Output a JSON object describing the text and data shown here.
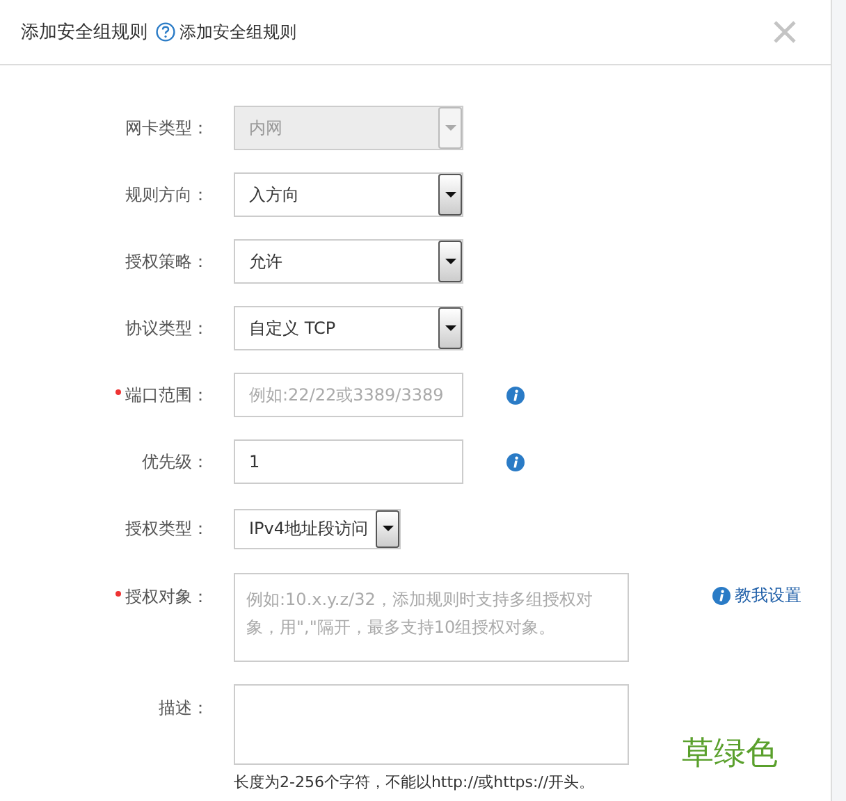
{
  "dialog": {
    "title": "添加安全组规则",
    "help_link": "添加安全组规则"
  },
  "fields": [
    {
      "kind": "select",
      "label": "网卡类型：",
      "required": false,
      "disabled": true,
      "value": "内网",
      "info": false
    },
    {
      "kind": "select",
      "label": "规则方向：",
      "required": false,
      "disabled": false,
      "value": "入方向",
      "info": false
    },
    {
      "kind": "select",
      "label": "授权策略：",
      "required": false,
      "disabled": false,
      "value": "允许",
      "info": false
    },
    {
      "kind": "select",
      "label": "协议类型：",
      "required": false,
      "disabled": false,
      "value": "自定义 TCP",
      "info": false
    },
    {
      "kind": "input",
      "label": "端口范围：",
      "required": true,
      "disabled": false,
      "placeholder": "例如:22/22或3389/3389",
      "info": true
    },
    {
      "kind": "input",
      "label": "优先级：",
      "required": false,
      "disabled": false,
      "value": "1",
      "info": true
    },
    {
      "kind": "compact_select",
      "label": "授权类型：",
      "required": false,
      "disabled": false,
      "value": "IPv4地址段访问",
      "info": false
    },
    {
      "kind": "textarea",
      "label": "授权对象：",
      "required": true,
      "disabled": false,
      "placeholder": "例如:10.x.y.z/32，添加规则时支持多组授权对象，用\",\"隔开，最多支持10组授权对象。",
      "info": false,
      "help_link": "教我设置"
    },
    {
      "kind": "textarea",
      "label": "描述：",
      "required": false,
      "disabled": false,
      "info": false,
      "hint": "长度为2-256个字符，不能以http://或https://开头。"
    }
  ],
  "annotation": "草绿色"
}
